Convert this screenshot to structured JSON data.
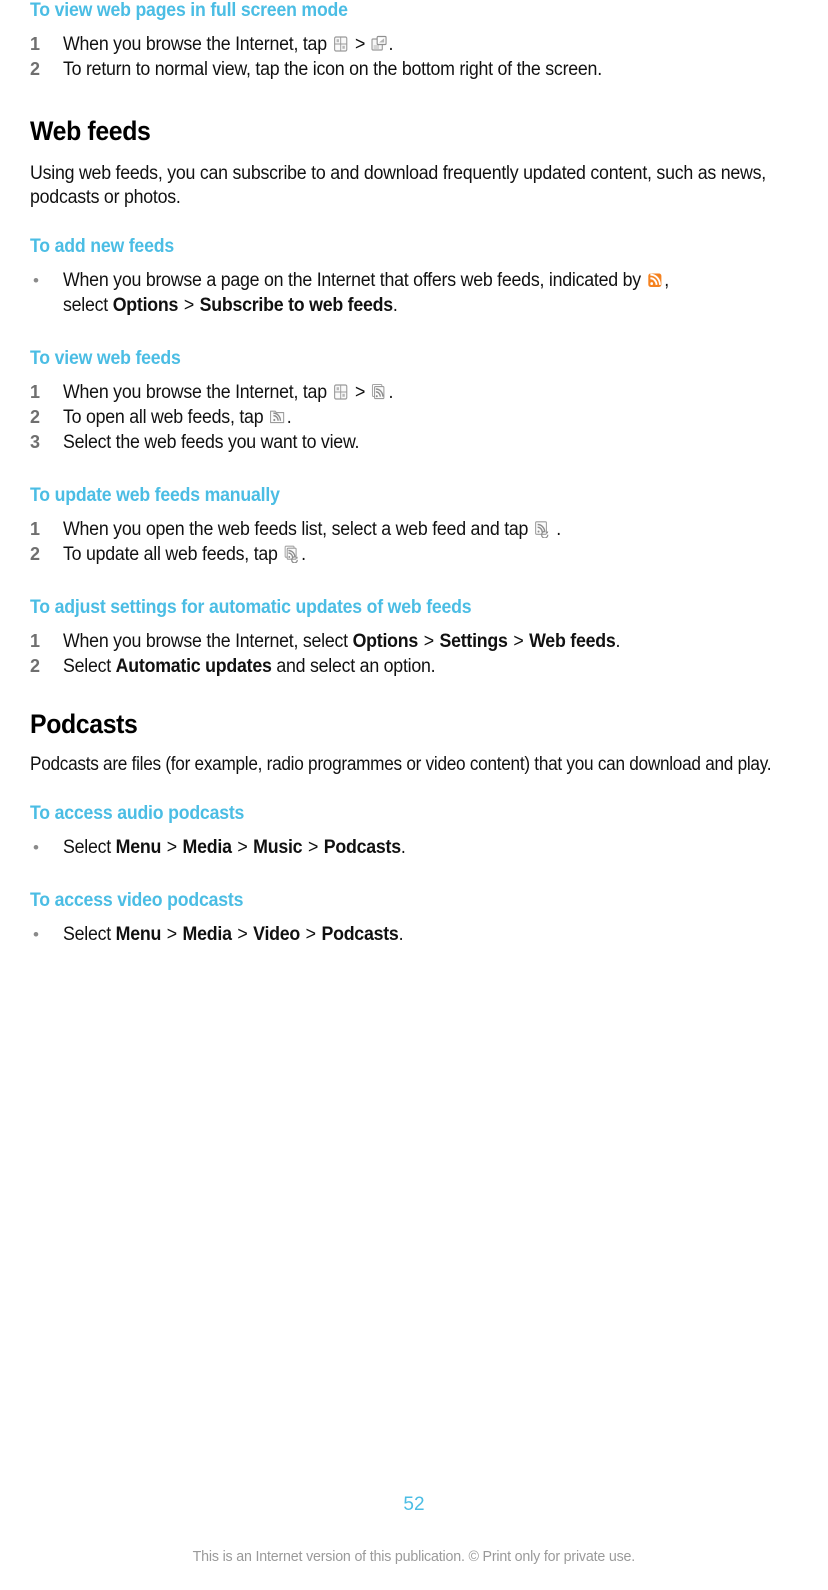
{
  "page": {
    "number": "52",
    "footnote": "This is an Internet version of this publication. © Print only for private use.",
    "accent_blue": "#4BBDE4",
    "body_black": "#111111",
    "marker_gray": "#6f6f6f",
    "rss_orange": "#F58220"
  },
  "sections": {
    "fullscreen": {
      "heading": "To view web pages in full screen mode",
      "steps": [
        {
          "marker": "1",
          "pre": "When you browse the Internet, tap ",
          "icon1": "browser-grid-icon",
          "sep": " > ",
          "icon2": "fullscreen-icon",
          "post": "."
        },
        {
          "marker": "2",
          "text": "To return to normal view, tap the icon on the bottom right of the screen."
        }
      ]
    },
    "web_feeds": {
      "title": "Web feeds",
      "intro": "Using web feeds, you can subscribe to and download frequently updated content, such as news, podcasts or photos.",
      "add": {
        "heading": "To add new feeds",
        "bullet_marker": "•",
        "line1_pre": "When you browse a page on the Internet that offers web feeds, indicated by ",
        "line1_icon": "rss-orange-icon",
        "line1_post": ",",
        "line2_pre": "select ",
        "line2_bold1": "Options",
        "line2_sep": " > ",
        "line2_bold2": "Subscribe to web feeds",
        "line2_post": "."
      },
      "view": {
        "heading": "To view web feeds",
        "steps": [
          {
            "marker": "1",
            "pre": "When you browse the Internet, tap ",
            "icon1": "browser-grid-icon",
            "sep": " > ",
            "icon2": "rss-stack-icon",
            "post": "."
          },
          {
            "marker": "2",
            "pre": "To open all web feeds, tap ",
            "icon1": "rss-folder-icon",
            "post": "."
          },
          {
            "marker": "3",
            "text": "Select the web feeds you want to view."
          }
        ]
      },
      "update": {
        "heading": "To update web feeds manually",
        "steps": [
          {
            "marker": "1",
            "pre": "When you open the web feeds list, select a web feed and tap ",
            "icon1": "rss-refresh-icon",
            "post": " ."
          },
          {
            "marker": "2",
            "pre": "To update all web feeds, tap ",
            "icon1": "rss-stack-refresh-icon",
            "post": "."
          }
        ]
      },
      "settings": {
        "heading": "To adjust settings for automatic updates of web feeds",
        "steps": [
          {
            "marker": "1",
            "pre": "When you browse the Internet, select ",
            "b1": "Options",
            "s1": " > ",
            "b2": "Settings",
            "s2": " > ",
            "b3": "Web feeds",
            "post": "."
          },
          {
            "marker": "2",
            "pre": "Select ",
            "b1": "Automatic updates",
            "post": " and select an option."
          }
        ]
      }
    },
    "podcasts": {
      "title": "Podcasts",
      "intro": "Podcasts are files (for example, radio programmes or video content) that you can download and play.",
      "audio": {
        "heading": "To access audio podcasts",
        "bullet_marker": "•",
        "pre": "Select ",
        "b1": "Menu",
        "s1": " > ",
        "b2": "Media",
        "s2": " > ",
        "b3": "Music",
        "s3": " > ",
        "b4": "Podcasts",
        "post": "."
      },
      "video": {
        "heading": "To access video podcasts",
        "bullet_marker": "•",
        "pre": "Select ",
        "b1": "Menu",
        "s1": " > ",
        "b2": "Media",
        "s2": " > ",
        "b3": "Video",
        "s3": " > ",
        "b4": "Podcasts",
        "post": "."
      }
    }
  }
}
